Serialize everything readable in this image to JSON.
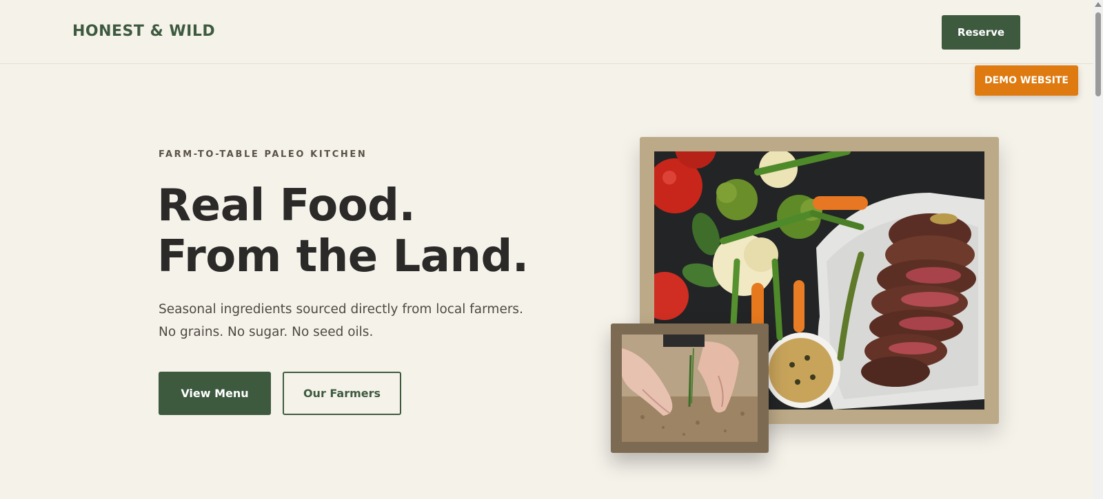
{
  "header": {
    "brand": "HONEST & WILD",
    "reserve_label": "Reserve",
    "demo_label": "DEMO WEBSITE"
  },
  "hero": {
    "eyebrow": "FARM-TO-TABLE PALEO KITCHEN",
    "headline_line1": "Real Food.",
    "headline_line2": "From the Land.",
    "subtext_line1": "Seasonal ingredients sourced directly from local farmers.",
    "subtext_line2": "No grains. No sugar. No seed oils.",
    "primary_cta": "View Menu",
    "secondary_cta": "Our Farmers"
  },
  "colors": {
    "background": "#f5f2ea",
    "brand_green": "#3d5a3f",
    "demo_orange": "#de7a0f",
    "frame_tan": "#bca987",
    "frame_brown": "#7d6a52"
  },
  "images": {
    "main_photo": "steak-and-vegetables-plate",
    "small_photo": "hands-planting-seedling-in-soil"
  }
}
